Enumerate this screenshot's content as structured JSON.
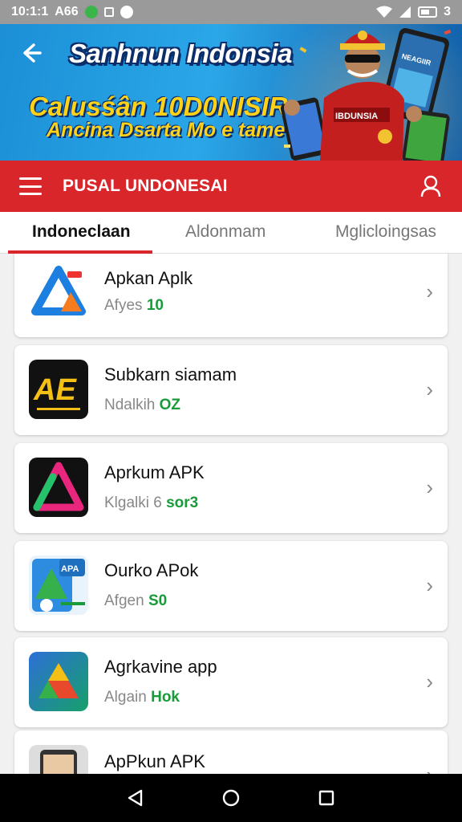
{
  "status_bar": {
    "time": "10:1:1",
    "network": "A66",
    "battery_text": "3"
  },
  "banner": {
    "title": "Sanhnun Indonsia",
    "subtitle_line1": "Calusśân 10D0NISIR",
    "subtitle_line2": "Ancina Dsarta Mo e tame",
    "badge_text": "IBDUNSIA",
    "phone_text": "NEAGIIR"
  },
  "app_bar": {
    "title": "PUSAL UNDONESAI"
  },
  "tabs": [
    {
      "label": "Indoneclaan",
      "active": true
    },
    {
      "label": "Aldonmam",
      "active": false
    },
    {
      "label": "Mglicloingsas",
      "active": false
    }
  ],
  "apps": [
    {
      "name": "Apkan Aplk",
      "meta": "Afyes",
      "highlight": "10",
      "icon": "triangle-blue-icon"
    },
    {
      "name": "Subkarn siamam",
      "meta": "Ndalkih",
      "highlight": "OZ",
      "icon": "ae-logo-icon",
      "icon_text": "AE"
    },
    {
      "name": "Aprkum APK",
      "meta": "Klgalki 6",
      "highlight": "sor3",
      "icon": "triangle-neon-icon"
    },
    {
      "name": "Ourko APok",
      "meta": "Afgen",
      "highlight": "S0",
      "icon": "apk-stack-icon",
      "icon_text": "APA"
    },
    {
      "name": "Agrkavine app",
      "meta": "Algain",
      "highlight": "Hok",
      "icon": "triangle-gradient-icon"
    },
    {
      "name": "ApPkun APK",
      "meta": "",
      "highlight": "",
      "icon": "tablet-icon"
    }
  ],
  "colors": {
    "accent_red": "#d9262b",
    "highlight_green": "#1a9b3a",
    "banner_blue": "#2aa7e8"
  }
}
